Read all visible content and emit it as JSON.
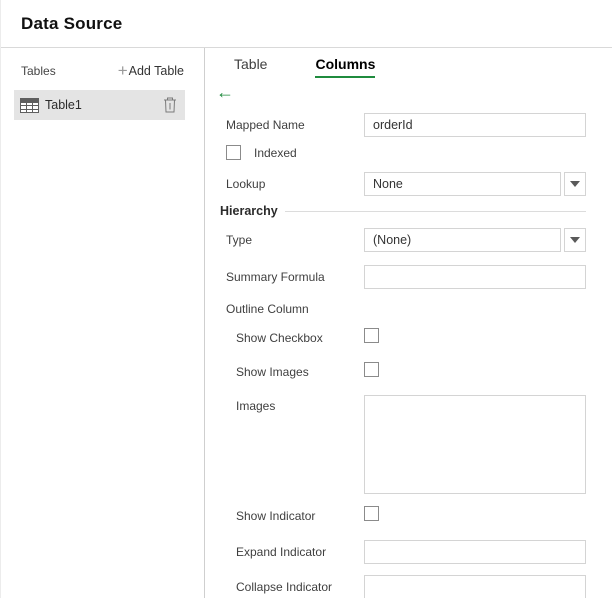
{
  "colors": {
    "accent_green": "#1f8b3e",
    "selected_row_bg": "#e4e4e4",
    "input_border": "#d4d4d4"
  },
  "header": {
    "title": "Data Source"
  },
  "sidebar": {
    "tables_label": "Tables",
    "add_table": {
      "label": "Add Table",
      "icon": "plus-icon",
      "glyph": "+"
    },
    "tables": [
      {
        "name": "Table1",
        "selected": true,
        "row_icon": "table-icon",
        "delete_icon": "trash-icon"
      }
    ]
  },
  "panel": {
    "tabs": [
      {
        "label": "Table",
        "active": false
      },
      {
        "label": "Columns",
        "active": true
      }
    ],
    "back": {
      "icon": "arrow-left-icon",
      "glyph": "←"
    },
    "form": {
      "mapped_name": {
        "label": "Mapped Name",
        "value": "orderId"
      },
      "indexed": {
        "label": "Indexed",
        "checked": false
      },
      "lookup": {
        "label": "Lookup",
        "value": "None"
      },
      "hierarchy_section": {
        "label": "Hierarchy"
      },
      "type": {
        "label": "Type",
        "value": "(None)"
      },
      "summary_formula": {
        "label": "Summary Formula",
        "value": ""
      },
      "outline_column": {
        "label": "Outline Column"
      },
      "show_checkbox": {
        "label": "Show Checkbox",
        "checked": false
      },
      "show_images": {
        "label": "Show Images",
        "checked": false
      },
      "images": {
        "label": "Images",
        "value": ""
      },
      "show_indicator": {
        "label": "Show Indicator",
        "checked": false
      },
      "expand_indicator": {
        "label": "Expand Indicator",
        "value": ""
      },
      "collapse_indicator": {
        "label": "Collapse Indicator",
        "value": ""
      }
    }
  }
}
